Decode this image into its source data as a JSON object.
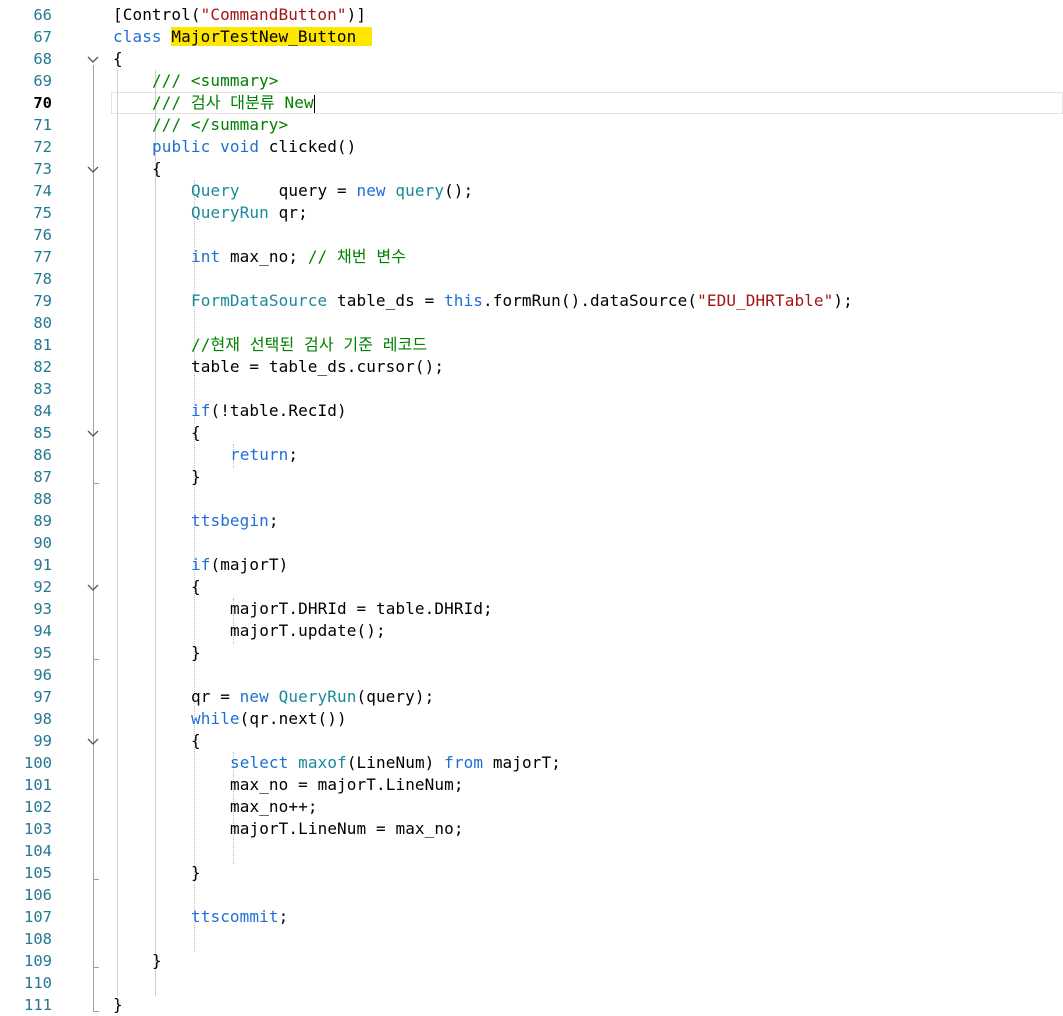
{
  "editor": {
    "current_line": 70,
    "lines": [
      {
        "num": "66",
        "indent": 1,
        "fold": "",
        "tokens": [
          {
            "c": "plain",
            "t": "[Control("
          },
          {
            "c": "str",
            "t": "\"CommandButton\""
          },
          {
            "c": "plain",
            "t": ")]"
          }
        ]
      },
      {
        "num": "67",
        "indent": 1,
        "fold": "",
        "tokens": [
          {
            "c": "kw",
            "t": "class "
          },
          {
            "c": "hl",
            "t": "MajorTestNew_Button"
          }
        ]
      },
      {
        "num": "68",
        "indent": 1,
        "fold": "open",
        "tokens": [
          {
            "c": "plain",
            "t": "{"
          }
        ]
      },
      {
        "num": "69",
        "indent": 2,
        "fold": "",
        "tokens": [
          {
            "c": "com",
            "t": "/// <summary>"
          }
        ]
      },
      {
        "num": "70",
        "indent": 2,
        "fold": "",
        "tokens": [
          {
            "c": "com",
            "t": "/// 검사 대분류 New"
          }
        ]
      },
      {
        "num": "71",
        "indent": 2,
        "fold": "",
        "tokens": [
          {
            "c": "com",
            "t": "/// </summary>"
          }
        ]
      },
      {
        "num": "72",
        "indent": 2,
        "fold": "",
        "tokens": [
          {
            "c": "kw",
            "t": "public void "
          },
          {
            "c": "plain",
            "t": "clicked()"
          }
        ]
      },
      {
        "num": "73",
        "indent": 2,
        "fold": "open",
        "tokens": [
          {
            "c": "plain",
            "t": "{"
          }
        ]
      },
      {
        "num": "74",
        "indent": 3,
        "fold": "",
        "tokens": [
          {
            "c": "type",
            "t": "Query"
          },
          {
            "c": "plain",
            "t": "    query = "
          },
          {
            "c": "kw",
            "t": "new "
          },
          {
            "c": "type",
            "t": "query"
          },
          {
            "c": "plain",
            "t": "();"
          }
        ]
      },
      {
        "num": "75",
        "indent": 3,
        "fold": "",
        "tokens": [
          {
            "c": "type",
            "t": "QueryRun"
          },
          {
            "c": "plain",
            "t": " qr;"
          }
        ]
      },
      {
        "num": "76",
        "indent": 3,
        "fold": "",
        "tokens": []
      },
      {
        "num": "77",
        "indent": 3,
        "fold": "",
        "tokens": [
          {
            "c": "kw",
            "t": "int "
          },
          {
            "c": "plain",
            "t": "max_no; "
          },
          {
            "c": "com",
            "t": "// 채번 변수"
          }
        ]
      },
      {
        "num": "78",
        "indent": 3,
        "fold": "",
        "tokens": []
      },
      {
        "num": "79",
        "indent": 3,
        "fold": "",
        "tokens": [
          {
            "c": "type",
            "t": "FormDataSource"
          },
          {
            "c": "plain",
            "t": " table_ds = "
          },
          {
            "c": "kw",
            "t": "this"
          },
          {
            "c": "plain",
            "t": ".formRun().dataSource("
          },
          {
            "c": "str",
            "t": "\"EDU_DHRTable\""
          },
          {
            "c": "plain",
            "t": ");"
          }
        ]
      },
      {
        "num": "80",
        "indent": 3,
        "fold": "",
        "tokens": []
      },
      {
        "num": "81",
        "indent": 3,
        "fold": "",
        "tokens": [
          {
            "c": "com",
            "t": "//현재 선택된 검사 기준 레코드"
          }
        ]
      },
      {
        "num": "82",
        "indent": 3,
        "fold": "",
        "tokens": [
          {
            "c": "plain",
            "t": "table = table_ds.cursor();"
          }
        ]
      },
      {
        "num": "83",
        "indent": 3,
        "fold": "",
        "tokens": []
      },
      {
        "num": "84",
        "indent": 3,
        "fold": "",
        "tokens": [
          {
            "c": "kw",
            "t": "if"
          },
          {
            "c": "plain",
            "t": "(!table.RecId)"
          }
        ]
      },
      {
        "num": "85",
        "indent": 3,
        "fold": "open",
        "tokens": [
          {
            "c": "plain",
            "t": "{"
          }
        ]
      },
      {
        "num": "86",
        "indent": 4,
        "fold": "",
        "tokens": [
          {
            "c": "kw",
            "t": "return"
          },
          {
            "c": "plain",
            "t": ";"
          }
        ]
      },
      {
        "num": "87",
        "indent": 3,
        "fold": "",
        "tokens": [
          {
            "c": "plain",
            "t": "}"
          }
        ]
      },
      {
        "num": "88",
        "indent": 3,
        "fold": "",
        "tokens": []
      },
      {
        "num": "89",
        "indent": 3,
        "fold": "",
        "tokens": [
          {
            "c": "kw",
            "t": "ttsbegin"
          },
          {
            "c": "plain",
            "t": ";"
          }
        ]
      },
      {
        "num": "90",
        "indent": 3,
        "fold": "",
        "tokens": []
      },
      {
        "num": "91",
        "indent": 3,
        "fold": "",
        "tokens": [
          {
            "c": "kw",
            "t": "if"
          },
          {
            "c": "plain",
            "t": "(majorT)"
          }
        ]
      },
      {
        "num": "92",
        "indent": 3,
        "fold": "open",
        "tokens": [
          {
            "c": "plain",
            "t": "{"
          }
        ]
      },
      {
        "num": "93",
        "indent": 4,
        "fold": "",
        "tokens": [
          {
            "c": "plain",
            "t": "majorT.DHRId = table.DHRId;"
          }
        ]
      },
      {
        "num": "94",
        "indent": 4,
        "fold": "",
        "tokens": [
          {
            "c": "plain",
            "t": "majorT.update();"
          }
        ]
      },
      {
        "num": "95",
        "indent": 3,
        "fold": "",
        "tokens": [
          {
            "c": "plain",
            "t": "}"
          }
        ]
      },
      {
        "num": "96",
        "indent": 3,
        "fold": "",
        "tokens": []
      },
      {
        "num": "97",
        "indent": 3,
        "fold": "",
        "tokens": [
          {
            "c": "plain",
            "t": "qr = "
          },
          {
            "c": "kw",
            "t": "new "
          },
          {
            "c": "type",
            "t": "QueryRun"
          },
          {
            "c": "plain",
            "t": "(query);"
          }
        ]
      },
      {
        "num": "98",
        "indent": 3,
        "fold": "",
        "tokens": [
          {
            "c": "kw",
            "t": "while"
          },
          {
            "c": "plain",
            "t": "(qr.next())"
          }
        ]
      },
      {
        "num": "99",
        "indent": 3,
        "fold": "open",
        "tokens": [
          {
            "c": "plain",
            "t": "{"
          }
        ]
      },
      {
        "num": "100",
        "indent": 4,
        "fold": "",
        "tokens": [
          {
            "c": "kw",
            "t": "select "
          },
          {
            "c": "type",
            "t": "maxof"
          },
          {
            "c": "plain",
            "t": "(LineNum) "
          },
          {
            "c": "kw",
            "t": "from "
          },
          {
            "c": "plain",
            "t": "majorT;"
          }
        ]
      },
      {
        "num": "101",
        "indent": 4,
        "fold": "",
        "tokens": [
          {
            "c": "plain",
            "t": "max_no = majorT.LineNum;"
          }
        ]
      },
      {
        "num": "102",
        "indent": 4,
        "fold": "",
        "tokens": [
          {
            "c": "plain",
            "t": "max_no++;"
          }
        ]
      },
      {
        "num": "103",
        "indent": 4,
        "fold": "",
        "tokens": [
          {
            "c": "plain",
            "t": "majorT.LineNum = max_no;"
          }
        ]
      },
      {
        "num": "104",
        "indent": 4,
        "fold": "",
        "tokens": []
      },
      {
        "num": "105",
        "indent": 3,
        "fold": "",
        "tokens": [
          {
            "c": "plain",
            "t": "}"
          }
        ]
      },
      {
        "num": "106",
        "indent": 3,
        "fold": "",
        "tokens": []
      },
      {
        "num": "107",
        "indent": 3,
        "fold": "",
        "tokens": [
          {
            "c": "kw",
            "t": "ttscommit"
          },
          {
            "c": "plain",
            "t": ";"
          }
        ]
      },
      {
        "num": "108",
        "indent": 3,
        "fold": "",
        "tokens": []
      },
      {
        "num": "109",
        "indent": 2,
        "fold": "",
        "tokens": [
          {
            "c": "plain",
            "t": "}"
          }
        ]
      },
      {
        "num": "110",
        "indent": 2,
        "fold": "",
        "tokens": []
      },
      {
        "num": "111",
        "indent": 1,
        "fold": "",
        "tokens": [
          {
            "c": "plain",
            "t": "}"
          }
        ]
      }
    ]
  },
  "colors": {
    "keyword": "#1f6fd6",
    "type": "#1a8a9a",
    "string": "#a31515",
    "comment": "#008000",
    "highlight": "#ffe600",
    "line_number": "#237893"
  },
  "icons": {
    "fold": "chevron-down-icon"
  }
}
